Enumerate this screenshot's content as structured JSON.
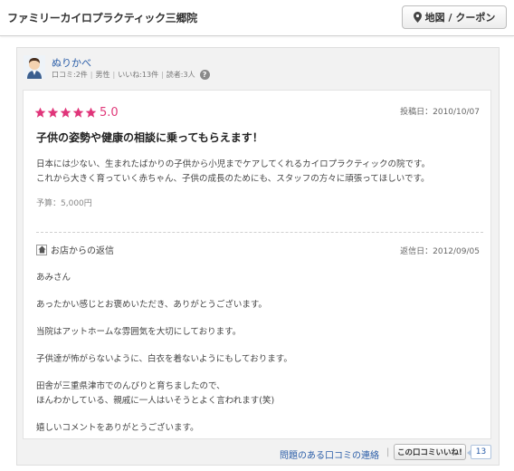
{
  "header": {
    "shop_name": "ファミリーカイロプラクティック三郷院",
    "map_button": "地図 / クーポン"
  },
  "reviewer": {
    "name": "ぬりかべ",
    "stats": [
      "口コミ:2件",
      "男性",
      "いいね:13件",
      "読者:3人"
    ]
  },
  "review": {
    "rating": "5.0",
    "stars": 5,
    "posted": "投稿日：2010/10/07",
    "title": "子供の姿勢や健康の相談に乗ってもらえます！",
    "body_line1": "日本には少ない、生まれたばかりの子供から小児までケアしてくれるカイロプラクティックの院です。",
    "body_line2": "これから大きく育っていく赤ちゃん、子供の成長のためにも、スタッフの方々に頑張ってほしいです。",
    "budget": "予算：5,000円"
  },
  "reply": {
    "label": "お店からの返信",
    "date": "返信日：2012/09/05",
    "lines": [
      "あみさん",
      "あったかい感じとお褒めいただき、ありがとうございます。",
      "当院はアットホームな雰囲気を大切にしております。",
      "子供達が怖がらないように、白衣を着ないようにもしております。",
      "田舎が三重県津市でのんびりと育ちましたので、",
      "ほんわかしている、親戚に一人はいそうとよく言われます(笑)",
      "嬉しいコメントをありがとうございます。"
    ]
  },
  "footer": {
    "report_link": "問題のある口コミの連絡",
    "separator": "|",
    "like_button": "この口コミいいね!",
    "like_count": "13"
  },
  "colors": {
    "star": "#e0357a",
    "link": "#2a5da8"
  }
}
